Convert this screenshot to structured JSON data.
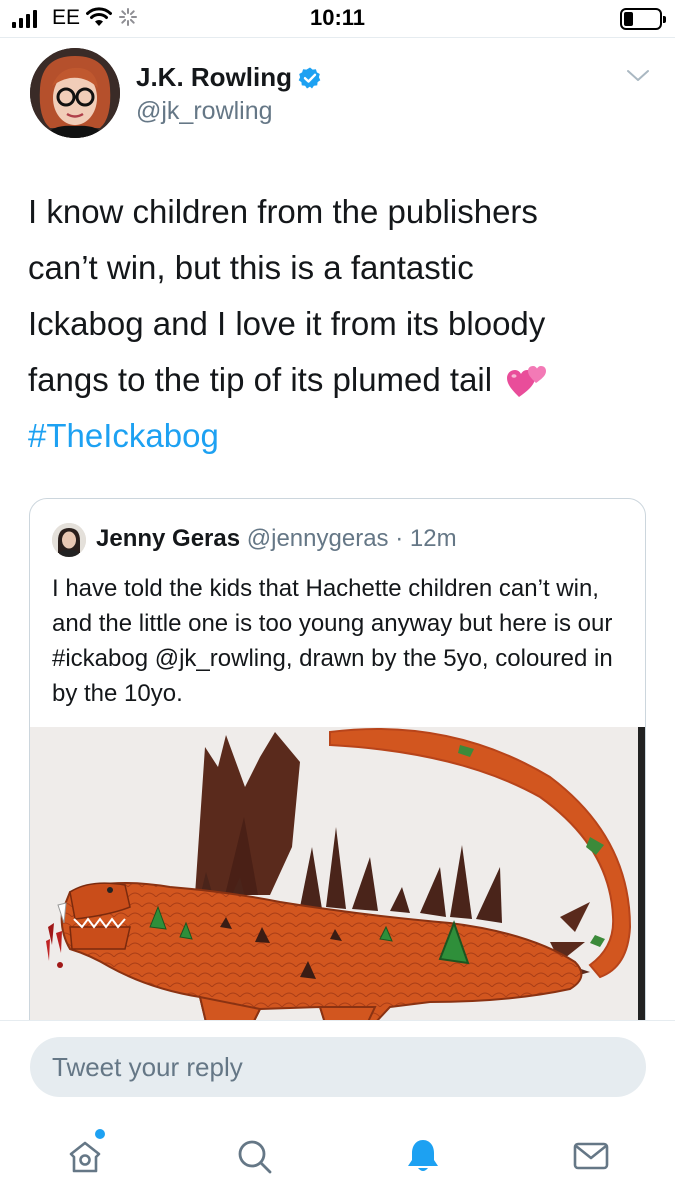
{
  "status_bar": {
    "carrier": "EE",
    "time": "10:11",
    "battery_level": 0.25
  },
  "tweet": {
    "author_name": "J.K. Rowling",
    "author_handle": "@jk_rowling",
    "verified": true,
    "text_lines": [
      "I know children from the publishers",
      "can’t win, but this is a fantastic",
      "Ickabog and I love it from its bloody",
      "fangs to the tip of its plumed tail"
    ],
    "emoji": "two-hearts",
    "hashtag": "#TheIckabog"
  },
  "quoted_tweet": {
    "author_name": "Jenny Geras",
    "author_handle": "@jennygeras",
    "separator": " · ",
    "age": "12m",
    "text": "I have told the kids that Hachette children can’t win, and the little one is too young anyway but here is our #ickabog @jk_rowling, drawn by the 5yo, coloured in by the 10yo."
  },
  "reply": {
    "placeholder": "Tweet your reply"
  },
  "tab_bar": {
    "items": [
      "home-icon",
      "search-icon",
      "notifications-icon",
      "messages-icon"
    ],
    "active": "notifications-icon",
    "home_has_new": true
  },
  "colors": {
    "accent": "#1da1f2",
    "secondary_text": "#657786",
    "divider": "#e6ecf0"
  }
}
